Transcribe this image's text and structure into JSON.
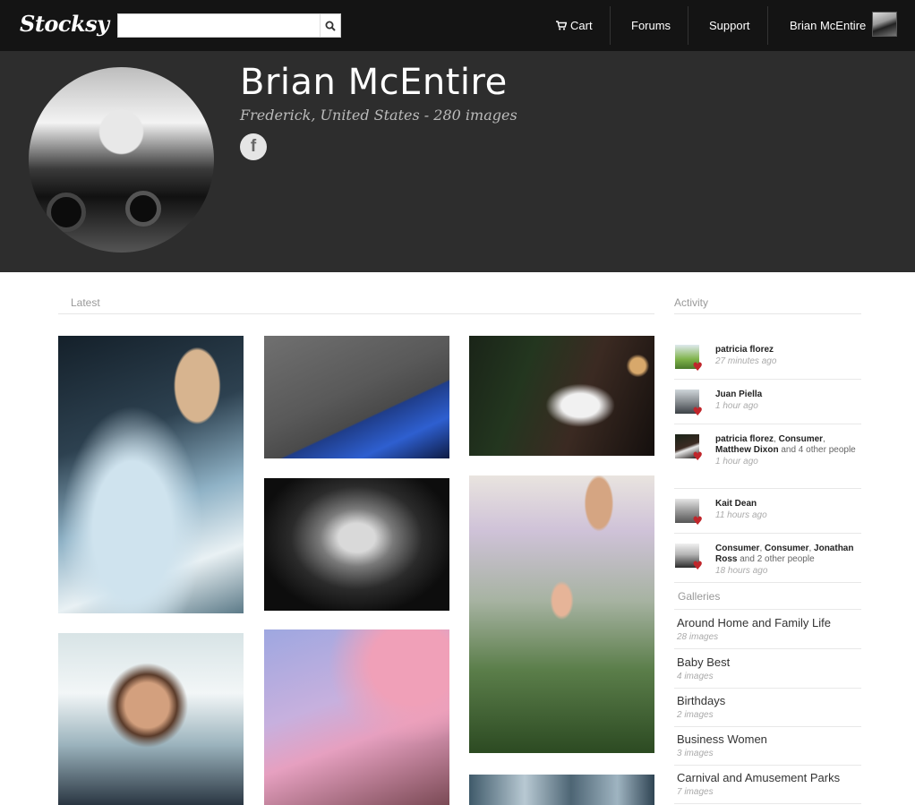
{
  "topbar": {
    "logo": "Stocksy",
    "search_placeholder": "",
    "search_icon": "search-icon",
    "cart_label": "Cart",
    "forums_label": "Forums",
    "support_label": "Support",
    "user_name": "Brian McEntire"
  },
  "profile": {
    "name": "Brian McEntire",
    "meta": "Frederick, United States - 280 images",
    "facebook_icon": "f"
  },
  "latest": {
    "heading": "Latest"
  },
  "activity": {
    "heading": "Activity",
    "items": [
      {
        "bold1": "patricia florez",
        "rest": "",
        "time": "27 minutes ago"
      },
      {
        "bold1": "Juan Piella",
        "rest": "",
        "time": "1 hour ago"
      },
      {
        "bold1": "patricia florez",
        "sep1": ", ",
        "bold2": "Consumer",
        "sep2": ",",
        "bold3": "Matthew Dixon",
        "rest": " and 4 other people",
        "time": "1 hour ago"
      },
      {
        "bold1": "Kait Dean",
        "rest": "",
        "time": "11 hours ago"
      },
      {
        "bold1": "Consumer",
        "sep1": ", ",
        "bold2": "Consumer",
        "sep2": ", ",
        "bold3": "Jonathan Ross",
        "rest": " and 2 other people",
        "time": "18 hours ago"
      }
    ]
  },
  "galleries": {
    "heading": "Galleries",
    "items": [
      {
        "title": "Around Home and Family Life",
        "count": "28 images"
      },
      {
        "title": "Baby Best",
        "count": "4 images"
      },
      {
        "title": "Birthdays",
        "count": "2 images"
      },
      {
        "title": "Business Women",
        "count": "3 images"
      },
      {
        "title": "Carnival and Amusement Parks",
        "count": "7 images"
      }
    ]
  },
  "colors": {
    "topbar_bg": "#141414",
    "profile_bg": "#2d2d2d",
    "heart": "#c0262b"
  }
}
